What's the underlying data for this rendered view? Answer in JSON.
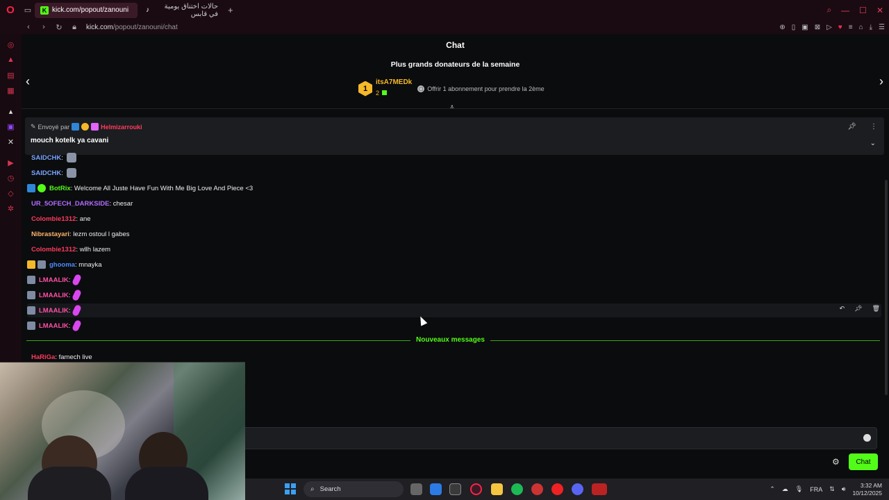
{
  "browser": {
    "tabs": [
      {
        "label": "kick.com/popout/zanouni",
        "active": true
      },
      {
        "label": "حالات اختناق يومية في قابس",
        "active": false
      }
    ],
    "url_host": "kick.com",
    "url_path": "/popout/zanouni/chat"
  },
  "chat": {
    "title": "Chat",
    "donors": {
      "title": "Plus grands donateurs de la semaine",
      "rank": "1",
      "name": "itsA7MEDk",
      "count": "2",
      "offer": "Offrir 1 abonnement pour prendre la 2ème"
    },
    "pinned": {
      "sent_by": "Envoyé par",
      "user": "Helmizarrouki",
      "message": "mouch kotelk ya cavani"
    },
    "messages": [
      {
        "user": "SAIDCHK",
        "text": "",
        "color": "#7aa6ff"
      },
      {
        "user": "SAIDCHK",
        "text": "",
        "color": "#7aa6ff"
      },
      {
        "user": "BotRix",
        "text": "Welcome All Juste Have Fun With Me Big Love And Piece <3",
        "color": "#53fc18"
      },
      {
        "user": "UR_5OFECH_DARKSIDE",
        "text": "chesar",
        "color": "#b16cff"
      },
      {
        "user": "Colombie1312",
        "text": "ane",
        "color": "#ff3b5c"
      },
      {
        "user": "Nibrastayari",
        "text": "lezm ostoul l gabes",
        "color": "#ffb46b"
      },
      {
        "user": "Colombie1312",
        "text": "wllh lazem",
        "color": "#ff3b5c"
      },
      {
        "user": "ghooma",
        "text": "mnayka",
        "color": "#4d8dff"
      },
      {
        "user": "LMAALIK",
        "text": "",
        "color": "#ff4fa3"
      },
      {
        "user": "LMAALIK",
        "text": "",
        "color": "#ff4fa3"
      },
      {
        "user": "LMAALIK",
        "text": "",
        "color": "#ff4fa3"
      },
      {
        "user": "LMAALIK",
        "text": "",
        "color": "#ff4fa3"
      }
    ],
    "new_messages_label": "Nouveaux messages",
    "after_message": {
      "user": "HaRiGa",
      "text": "famech live",
      "color": "#ff3b5c"
    },
    "send_label": "Chat"
  },
  "taskbar": {
    "search_label": "Search",
    "language": "FRA",
    "time": "3:32 AM",
    "date": "10/12/2025"
  },
  "colors": {
    "accent": "#53fc18",
    "opera": "#ff2244"
  }
}
